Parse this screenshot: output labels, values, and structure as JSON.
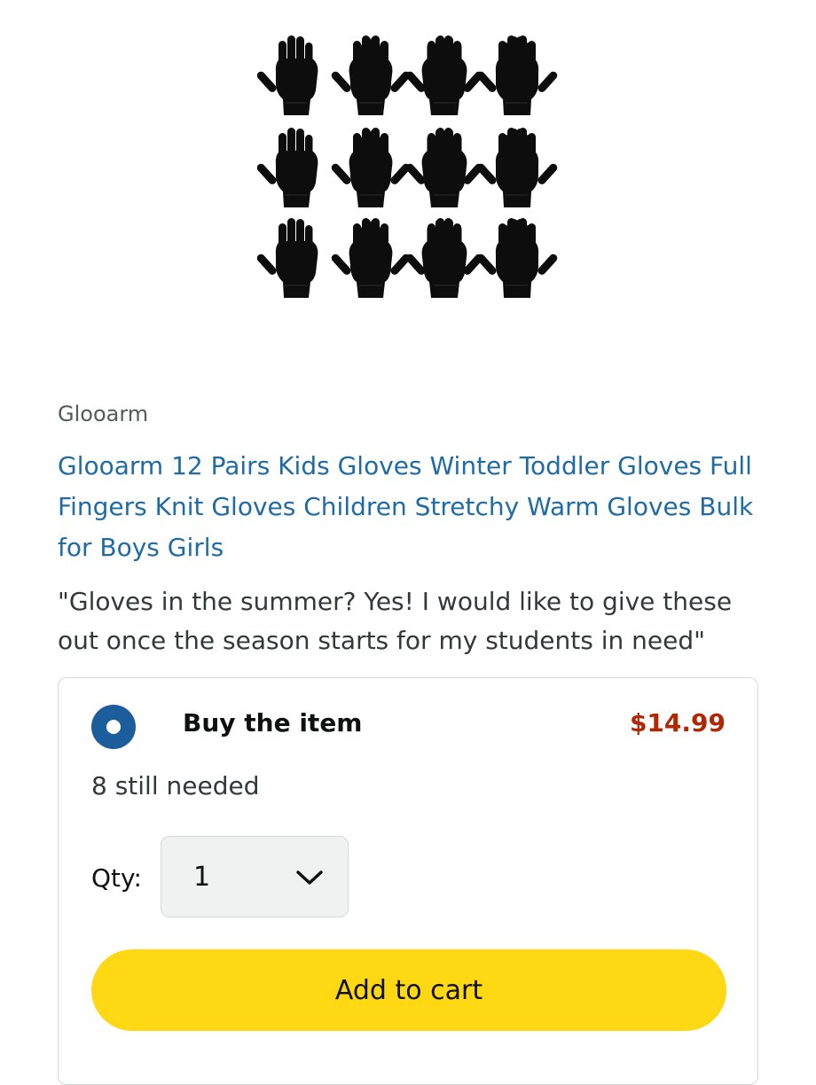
{
  "product": {
    "image_icon": "gloves-image",
    "brand": "Glooarm",
    "title": "Glooarm 12 Pairs Kids Gloves Winter Toddler Gloves Full Fingers Knit Gloves Children Stretchy Warm Gloves Bulk for Boys Girls",
    "note": "\"Gloves in the summer? Yes! I would like to give these out once the season starts for my students in need\""
  },
  "purchase": {
    "option_label": "Buy the item",
    "price": "$14.99",
    "still_needed": "8 still needed",
    "qty_label": "Qty:",
    "qty_value": "1",
    "add_to_cart_label": "Add to cart"
  },
  "colors": {
    "link_blue": "#1f6ba6",
    "price_red": "#b12704",
    "button_yellow": "#ffd814",
    "radio_blue": "#1c5e9b"
  }
}
